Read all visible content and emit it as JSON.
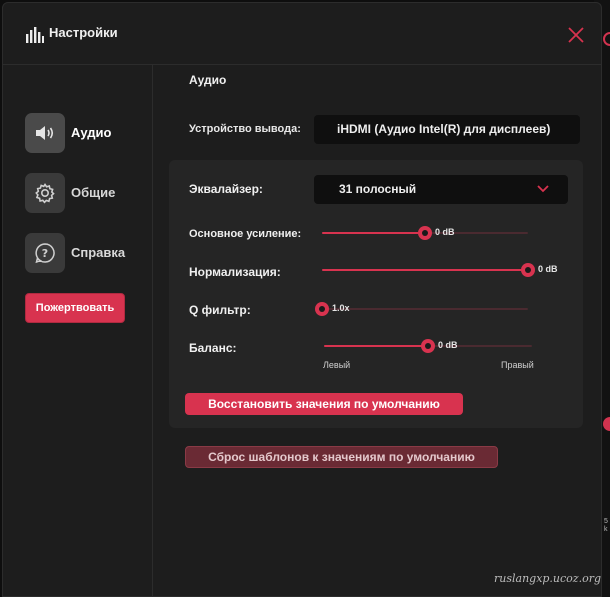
{
  "window": {
    "title": "Настройки"
  },
  "sidebar": {
    "items": [
      {
        "label": "Аудио",
        "icon": "speaker-icon",
        "active": true
      },
      {
        "label": "Общие",
        "icon": "gear-icon",
        "active": false
      },
      {
        "label": "Справка",
        "icon": "help-icon",
        "active": false
      }
    ],
    "donate_label": "Пожертвовать"
  },
  "audio": {
    "section_title": "Аудио",
    "output_device_label": "Устройство вывода:",
    "output_device_value": "iHDMI (Аудио Intel(R) для дисплеев)",
    "equalizer_label": "Эквалайзер:",
    "equalizer_value": "31 полосный",
    "gain": {
      "label": "Основное усиление:",
      "value": "0 dB",
      "level": 0.5
    },
    "normalization": {
      "label": "Нормализация:",
      "value": "0 dB",
      "level": 1.0
    },
    "q_filter": {
      "label": "Q фильтр:",
      "value": "1.0x",
      "level": 0.0
    },
    "balance": {
      "label": "Баланс:",
      "value": "0 dB",
      "level": 0.5,
      "left_label": "Левый",
      "right_label": "Правый"
    },
    "restore_defaults_label": "Восстановить значения по умолчанию",
    "reset_presets_label": "Сброс шаблонов к значениям по умолчанию"
  },
  "watermark": "ruslangxp.ucoz.org",
  "colors": {
    "accent": "#d8334f",
    "panel": "#252525",
    "window": "#1d1d1d",
    "field": "#0f0f0f"
  }
}
